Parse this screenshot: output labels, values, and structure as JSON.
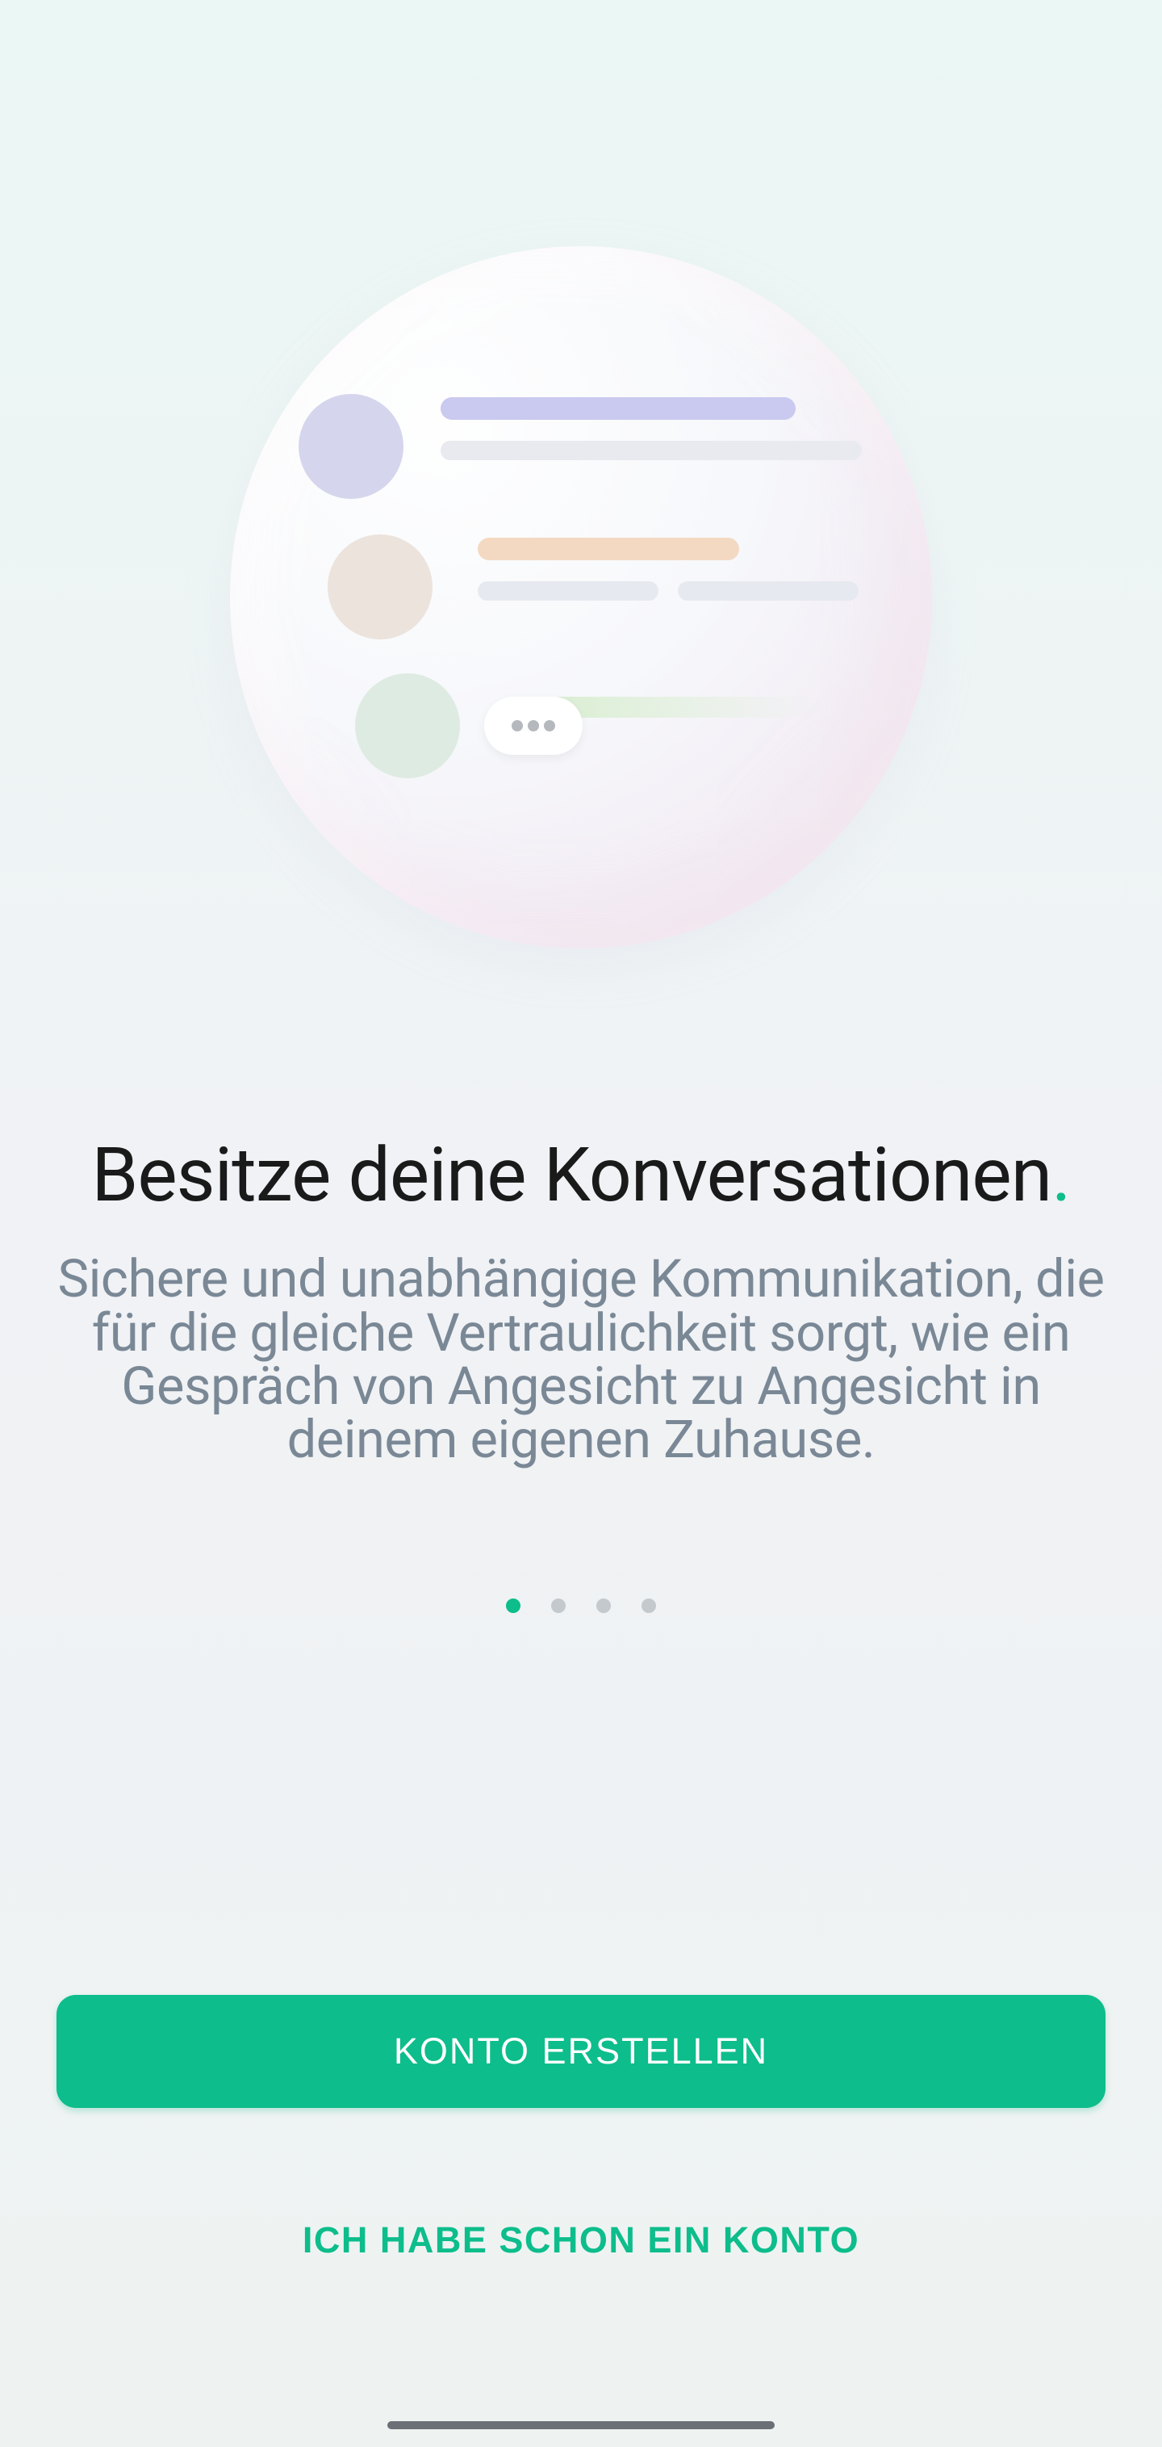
{
  "illustration": {
    "name": "chat-bubble-illustration"
  },
  "onboarding": {
    "title": "Besitze deine Konversationen",
    "title_punct": ".",
    "subtitle": "Sichere und unabhängige Kommunikation, die für die gleiche Vertraulichkeit sorgt, wie ein Gespräch von Angesicht zu Angesicht in deinem eigenen Zuhause.",
    "page_count": 4,
    "active_page": 0
  },
  "buttons": {
    "create_account": "KONTO ERSTELLEN",
    "have_account": "ICH HABE SCHON EIN KONTO"
  }
}
